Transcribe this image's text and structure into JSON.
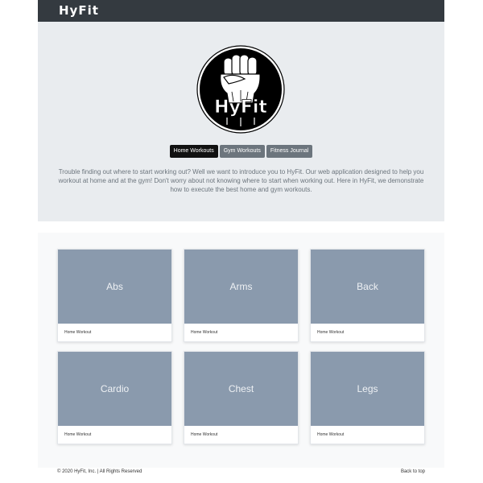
{
  "navbar": {
    "brand": "HyFit"
  },
  "hero": {
    "logo_text": "HyFit",
    "buttons": [
      {
        "label": "Home Workouts",
        "style": "dark"
      },
      {
        "label": "Gym Workouts",
        "style": "gray"
      },
      {
        "label": "Fitness Journal",
        "style": "gray"
      }
    ],
    "lead": "Trouble finding out where to start working out? Well we want to introduce you to HyFit. Our web application designed to help you workout at home and at the gym! Don't worry about not knowing where to start when working out. Here in HyFit, we demonstrate how to execute the best home and gym workouts."
  },
  "cards": [
    {
      "title": "Abs",
      "subtitle": "Home Workout"
    },
    {
      "title": "Arms",
      "subtitle": "Home Workout"
    },
    {
      "title": "Back",
      "subtitle": "Home Workout"
    },
    {
      "title": "Cardio",
      "subtitle": "Home Workout"
    },
    {
      "title": "Chest",
      "subtitle": "Home Workout"
    },
    {
      "title": "Legs",
      "subtitle": "Home Workout"
    }
  ],
  "footer": {
    "copyright": "© 2020 HyFit, Inc. | All Rights Reserved",
    "back_to_top": "Back to top"
  },
  "colors": {
    "navbar": "#343a40",
    "hero_bg": "#e9ecef",
    "card_image": "#8a9aad",
    "primary_button": "#111111",
    "secondary_button": "#6c757d"
  }
}
